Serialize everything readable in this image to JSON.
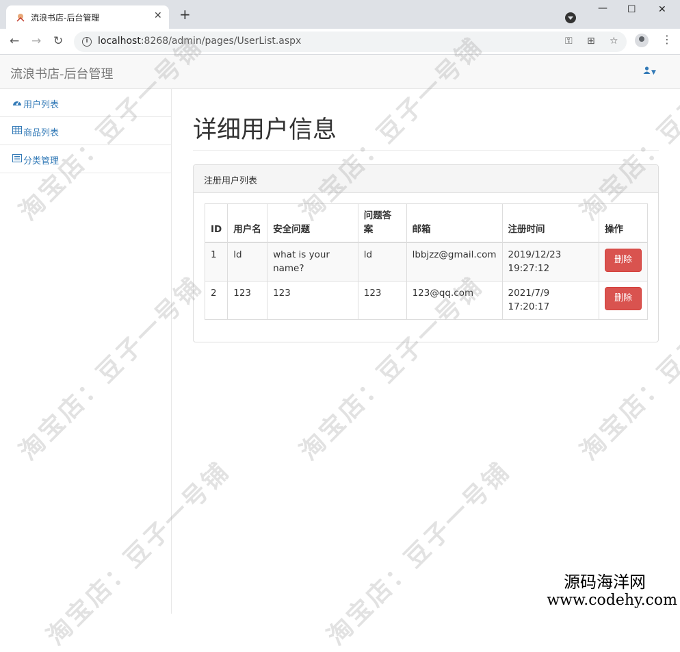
{
  "browser": {
    "tab_title": "流浪书店-后台管理",
    "url_host": "localhost",
    "url_rest": ":8268/admin/pages/UserList.aspx"
  },
  "app": {
    "brand": "流浪书店-后台管理"
  },
  "sidebar": {
    "items": [
      {
        "label": "用户列表",
        "icon": "dashboard-icon"
      },
      {
        "label": "商品列表",
        "icon": "table-icon"
      },
      {
        "label": "分类管理",
        "icon": "list-icon"
      }
    ]
  },
  "page": {
    "title": "详细用户信息",
    "panel_title": "注册用户列表"
  },
  "table": {
    "headers": [
      "ID",
      "用户名",
      "安全问题",
      "问题答案",
      "邮箱",
      "注册时间",
      "操作"
    ],
    "rows": [
      {
        "id": "1",
        "username": "ld",
        "question": "what is your name?",
        "answer": "ld",
        "email": "lbbjzz@gmail.com",
        "time": "2019/12/23 19:27:12",
        "action": "删除"
      },
      {
        "id": "2",
        "username": "123",
        "question": "123",
        "answer": "123",
        "email": "123@qq.com",
        "time": "2021/7/9 17:20:17",
        "action": "删除"
      }
    ]
  },
  "watermark": {
    "text": "淘宝店：豆子一号铺",
    "site_cn": "源码海洋网",
    "site_en": "www.codehy.com"
  },
  "colors": {
    "link": "#337ab7",
    "danger": "#d9534f"
  }
}
